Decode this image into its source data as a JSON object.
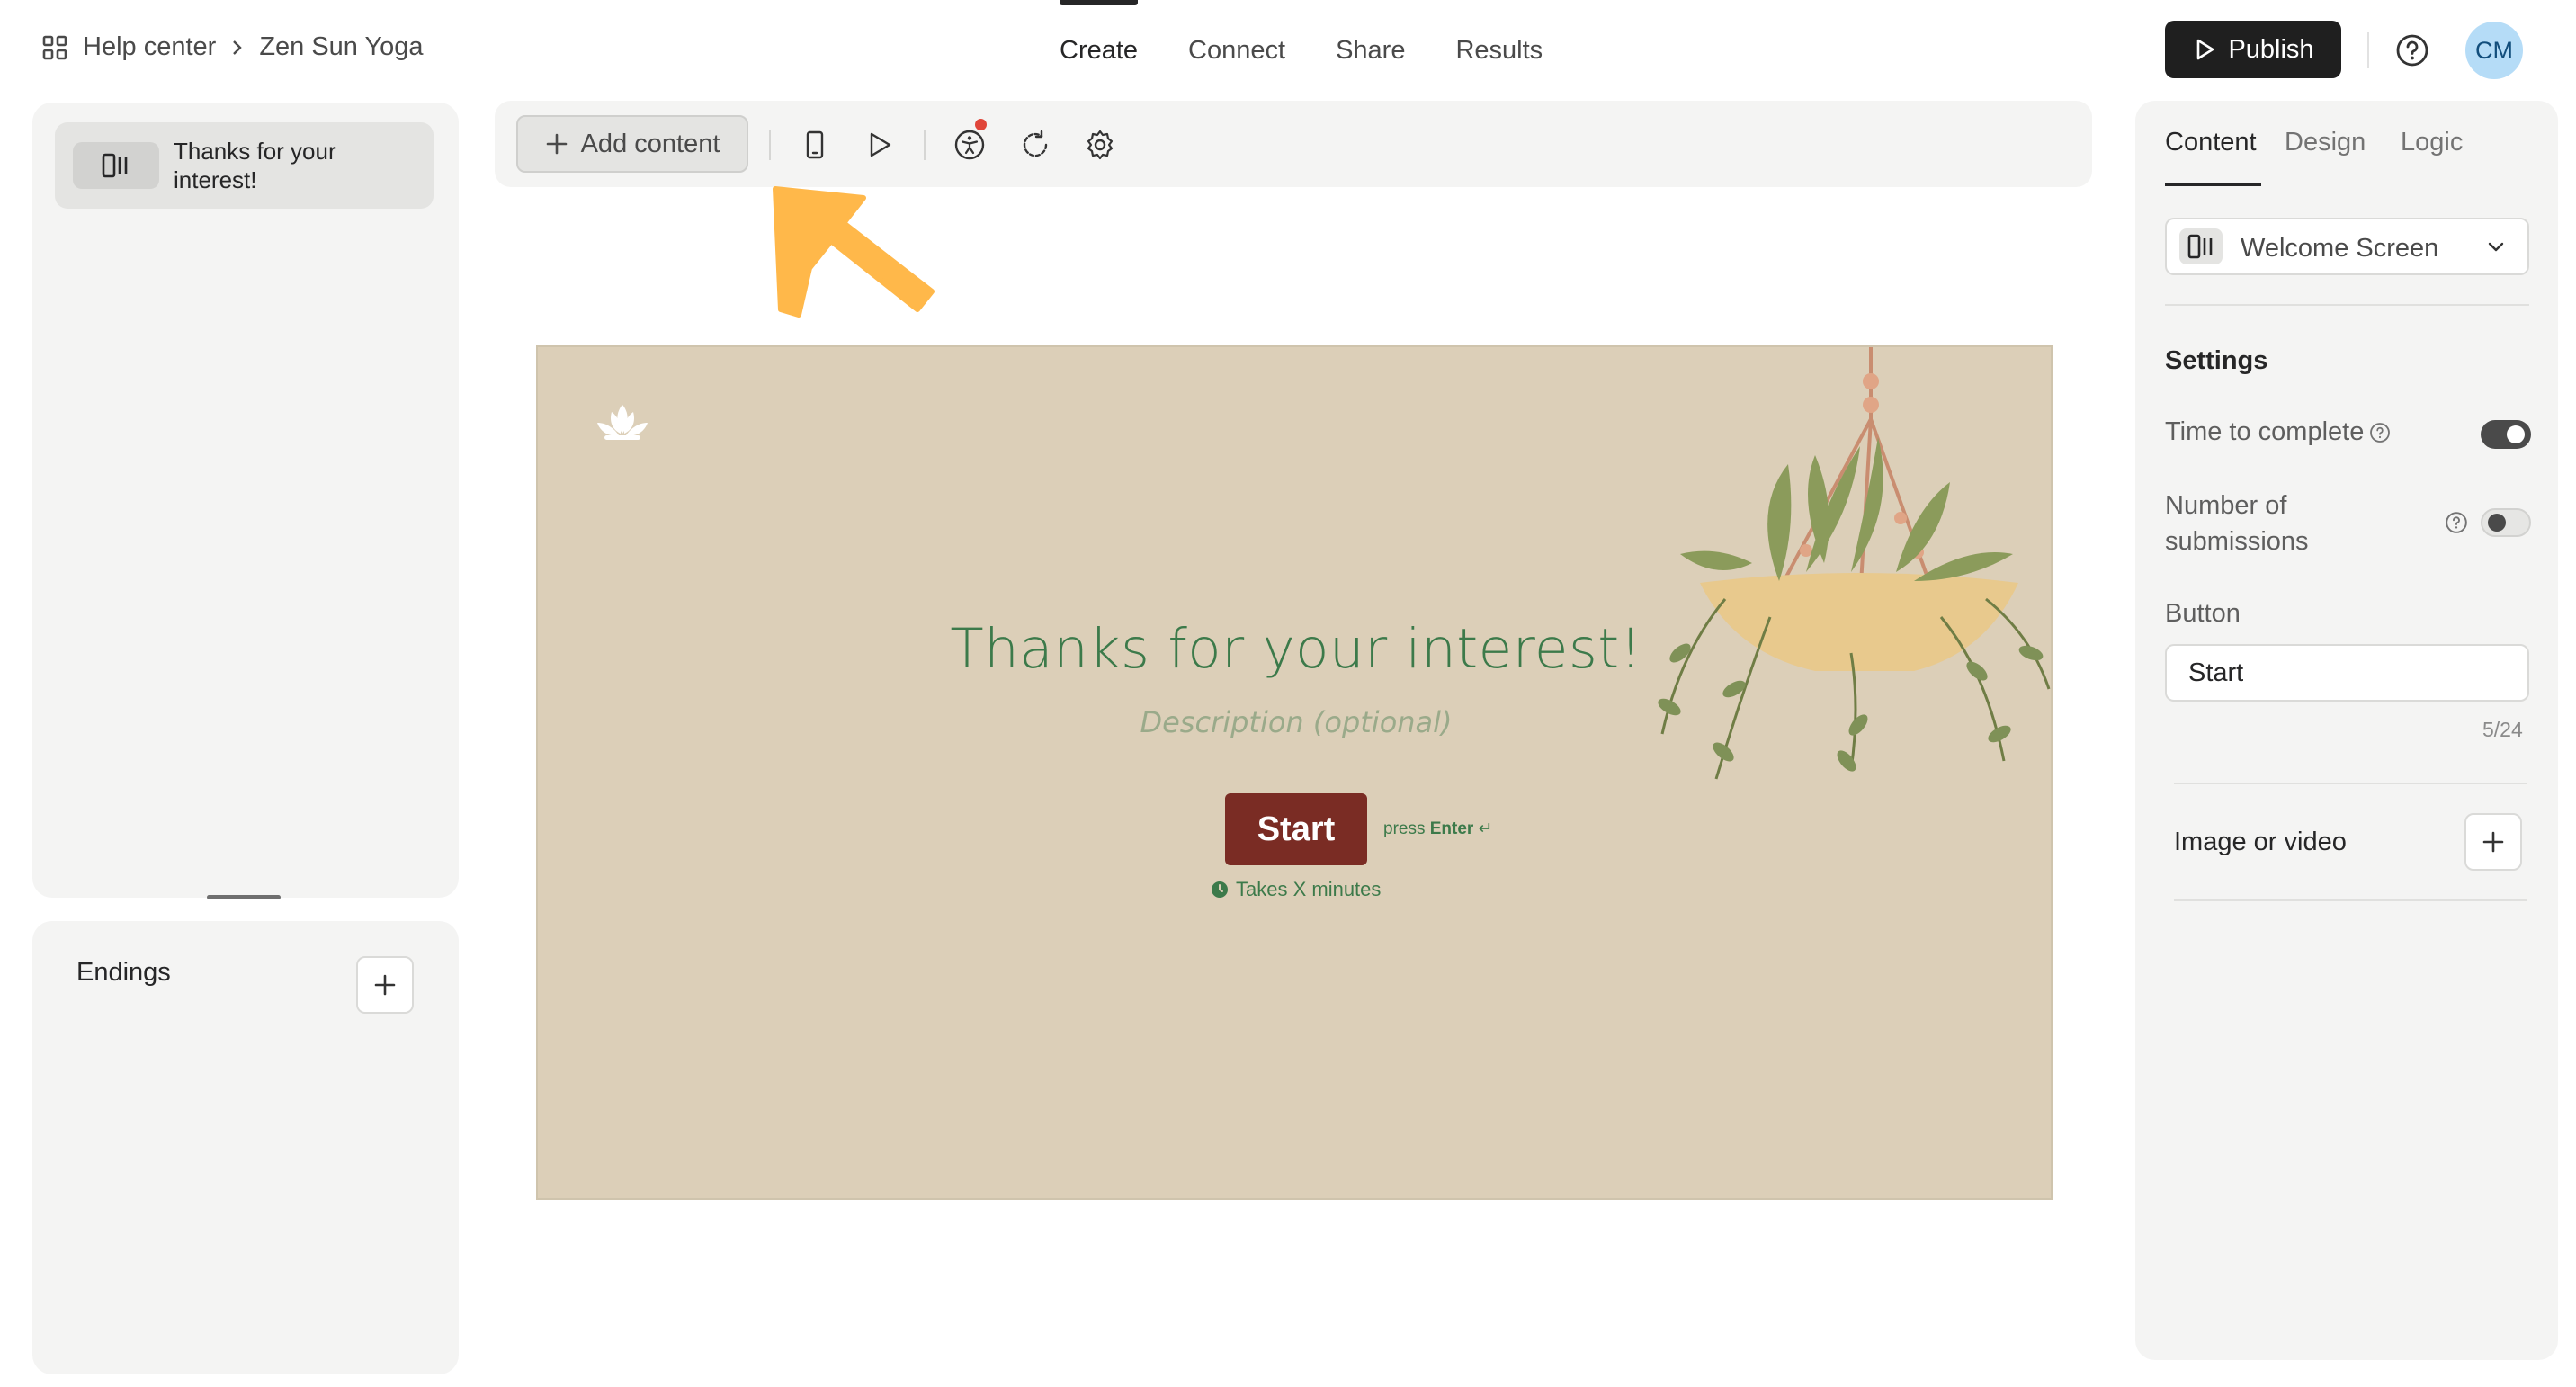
{
  "breadcrumb": {
    "root": "Help center",
    "current": "Zen Sun Yoga"
  },
  "nav": {
    "tabs": [
      "Create",
      "Connect",
      "Share",
      "Results"
    ],
    "active": "Create"
  },
  "header": {
    "publish_label": "Publish",
    "avatar_initials": "CM"
  },
  "left_panel": {
    "pages": [
      {
        "label": "Thanks for your interest!"
      }
    ],
    "endings_label": "Endings"
  },
  "toolbar": {
    "add_content_label": "Add content"
  },
  "canvas": {
    "title": "Thanks for your interest!",
    "description_placeholder": "Description (optional)",
    "button_label": "Start",
    "press_prefix": "press",
    "press_key": "Enter",
    "press_symbol": "↵",
    "time_text": "Takes X minutes"
  },
  "right_panel": {
    "tabs": [
      "Content",
      "Design",
      "Logic"
    ],
    "active_tab": "Content",
    "screen_type": "Welcome Screen",
    "settings_heading": "Settings",
    "time_to_complete": {
      "label": "Time to complete",
      "enabled": true
    },
    "number_of_submissions": {
      "label": "Number of submissions",
      "enabled": false
    },
    "button_section": {
      "label": "Button",
      "value": "Start",
      "counter": "5/24"
    },
    "media": {
      "label": "Image or video"
    }
  },
  "colors": {
    "canvas_bg": "#dccfb8",
    "title_green": "#3c7a4a",
    "start_button": "#7a2c24",
    "annotation_arrow": "#ffb84a",
    "publish_bg": "#1f1f1f",
    "avatar_bg": "#b5dcf7"
  },
  "icons": [
    "grid-icon",
    "chevron-right-icon",
    "play-icon",
    "help-icon",
    "welcome-screen-icon",
    "plus-icon",
    "mobile-icon",
    "preview-play-icon",
    "accessibility-icon",
    "refresh-icon",
    "gear-icon",
    "chevron-down-icon",
    "question-icon",
    "lotus-logo",
    "hanging-plant-illustration",
    "clock-icon"
  ]
}
